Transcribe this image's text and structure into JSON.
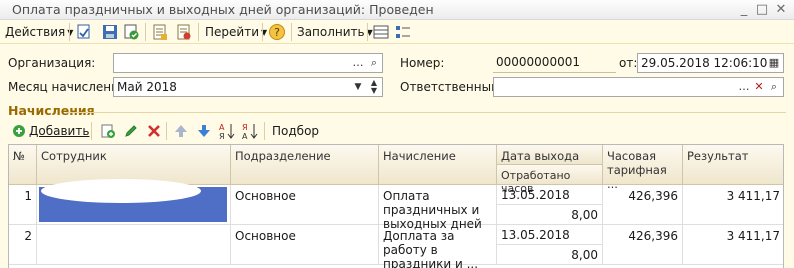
{
  "window": {
    "title": "Оплата праздничных и выходных дней организаций: Проведен"
  },
  "toolbar": {
    "actions_label": "Действия",
    "goto_label": "Перейти",
    "fill_label": "Заполнить"
  },
  "form": {
    "organization_label": "Организация:",
    "organization_value": "",
    "number_label": "Номер:",
    "number_value": "00000000001",
    "date_label": "от:",
    "date_value": "29.05.2018 12:06:10",
    "month_label": "Месяц начисления:",
    "month_value": "Май 2018",
    "responsible_label": "Ответственный:",
    "responsible_value": ""
  },
  "accruals": {
    "section_title": "Начисления",
    "add_label": "Добавить",
    "select_label": "Подбор",
    "columns": {
      "num": "№",
      "employee": "Сотрудник",
      "department": "Подразделение",
      "accrual": "Начисление",
      "date_out": "Дата выхода",
      "hours_worked": "Отработано часов",
      "hourly_rate": "Часовая тарифная ...",
      "result": "Результат"
    },
    "rows": [
      {
        "num": "1",
        "employee": "",
        "department": "Основное",
        "accrual": "Оплата праздничных и выходных дней",
        "date": "13.05.2018",
        "hours": "8,00",
        "rate": "426,396",
        "result": "3 411,17"
      },
      {
        "num": "2",
        "employee": "",
        "department": "Основное",
        "accrual": "Доплата за работу в праздники и ...",
        "date": "13.05.2018",
        "hours": "8,00",
        "rate": "426,396",
        "result": "3 411,17"
      }
    ]
  },
  "colors": {
    "accent": "#9a6a00",
    "selection": "#4f6fc6",
    "background": "#fffbe6"
  }
}
